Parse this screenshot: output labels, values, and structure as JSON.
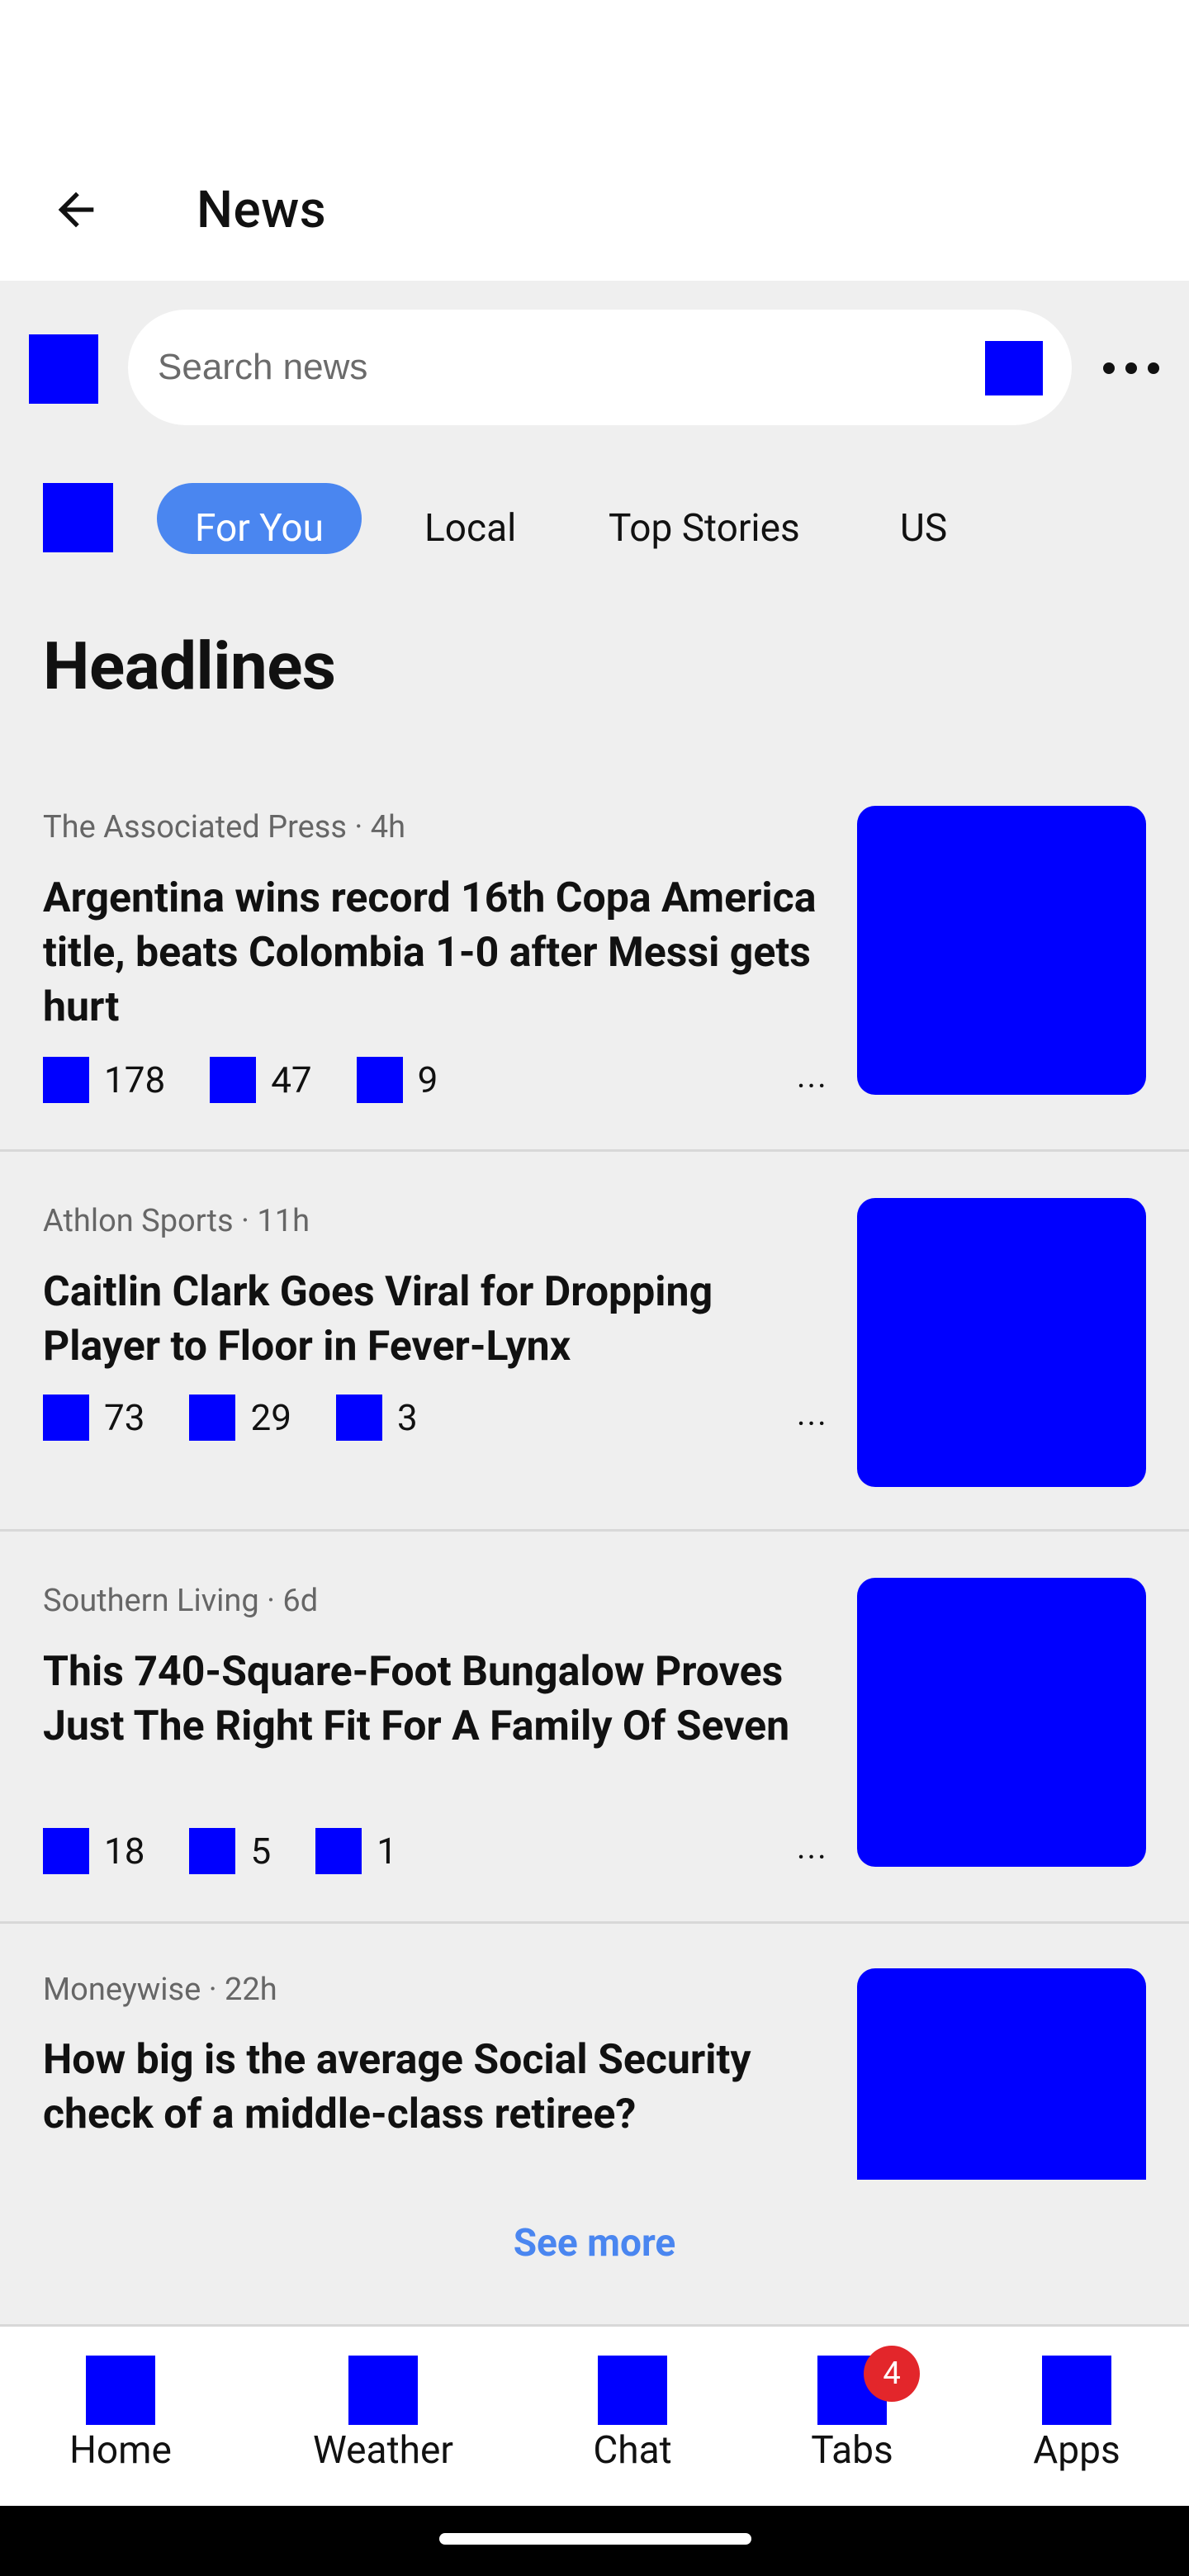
{
  "app_bar": {
    "title": "News"
  },
  "search": {
    "placeholder": "Search news",
    "value": ""
  },
  "tabs": [
    {
      "label": "For You",
      "active": true
    },
    {
      "label": "Local",
      "active": false
    },
    {
      "label": "Top Stories",
      "active": false
    },
    {
      "label": "US",
      "active": false
    }
  ],
  "section": {
    "title": "Headlines"
  },
  "articles": [
    {
      "source": "The Associated Press · 4h",
      "headline": "Argentina wins record 16th Copa America title, beats Colombia 1-0 after Messi gets hurt",
      "reactions": "178",
      "comments": "47",
      "shares": "9",
      "more": "..."
    },
    {
      "source": "Athlon Sports · 11h",
      "headline": "Caitlin Clark Goes Viral for Dropping Player to Floor in Fever-Lynx",
      "reactions": "73",
      "comments": "29",
      "shares": "3",
      "more": "..."
    },
    {
      "source": "Southern Living · 6d",
      "headline": "This 740-Square-Foot Bungalow Proves Just The Right Fit For A Family Of Seven",
      "reactions": "18",
      "comments": "5",
      "shares": "1",
      "more": "..."
    },
    {
      "source": "Moneywise · 22h",
      "headline": "How big is the average Social Security check of a middle-class retiree?"
    }
  ],
  "see_more": "See more",
  "bottom_nav": [
    {
      "label": "Home"
    },
    {
      "label": "Weather"
    },
    {
      "label": "Chat"
    },
    {
      "label": "Tabs",
      "badge": "4"
    },
    {
      "label": "Apps"
    }
  ],
  "colors": {
    "accent": "#4a86f0",
    "placeholder_icon": "#0000ff",
    "badge": "#e3262b"
  }
}
